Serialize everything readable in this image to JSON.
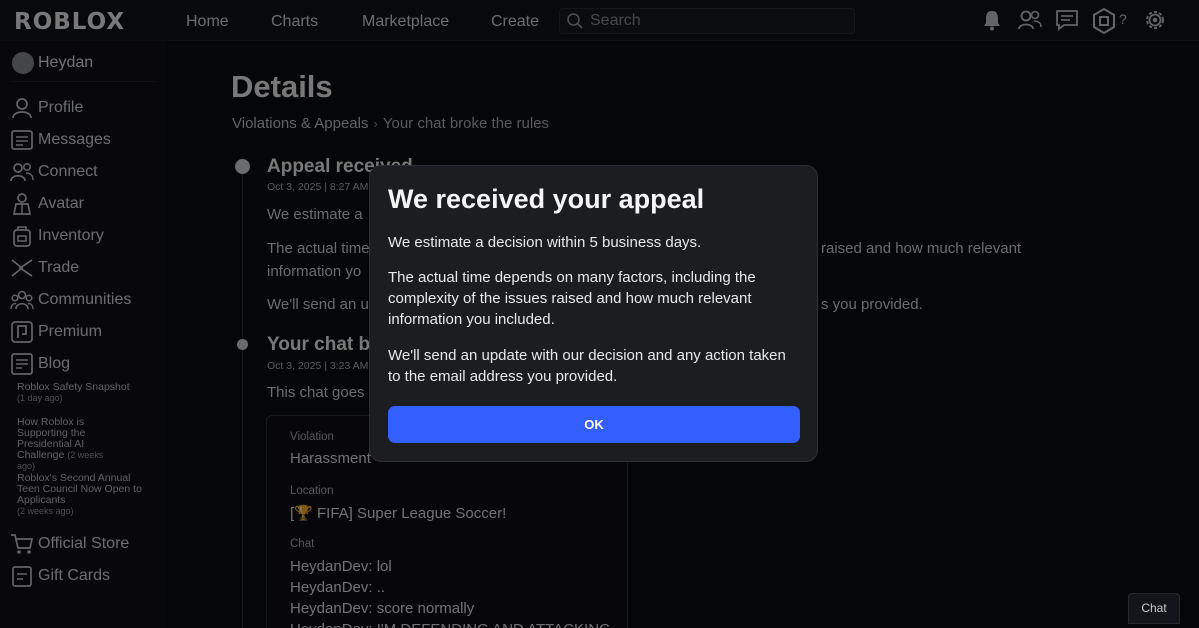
{
  "topbar": {
    "logo": "ROBLOX",
    "nav": [
      "Home",
      "Charts",
      "Marketplace",
      "Create"
    ],
    "search_placeholder": "Search",
    "robux_help": "?",
    "icons": [
      "bell-icon",
      "friends-icon",
      "chat-icon",
      "robux-icon",
      "settings-icon"
    ]
  },
  "sidebar": {
    "username": "Heydan",
    "items": [
      {
        "label": "Profile",
        "icon": "profile-icon"
      },
      {
        "label": "Messages",
        "icon": "messages-icon"
      },
      {
        "label": "Connect",
        "icon": "connect-icon"
      },
      {
        "label": "Avatar",
        "icon": "avatar-icon"
      },
      {
        "label": "Inventory",
        "icon": "inventory-icon"
      },
      {
        "label": "Trade",
        "icon": "trade-icon"
      },
      {
        "label": "Communities",
        "icon": "communities-icon"
      },
      {
        "label": "Premium",
        "icon": "premium-icon"
      },
      {
        "label": "Blog",
        "icon": "blog-icon"
      }
    ],
    "blog_posts": [
      {
        "title": "Roblox Safety Snapshot",
        "ago": "(1 day ago)"
      },
      {
        "title": "How Roblox is Supporting the Presidential AI Challenge",
        "ago": "(2 weeks ago)"
      },
      {
        "title": "Roblox's Second Annual Teen Council Now Open to Applicants",
        "ago": "(2 weeks ago)"
      }
    ],
    "bottom_items": [
      {
        "label": "Official Store",
        "icon": "cart-icon"
      },
      {
        "label": "Gift Cards",
        "icon": "gift-card-icon"
      }
    ]
  },
  "main": {
    "title": "Details",
    "breadcrumb": {
      "parent": "Violations & Appeals",
      "separator": "›",
      "current": "Your chat broke the rules"
    },
    "events": [
      {
        "title": "Appeal received",
        "time": "Oct 3, 2025 | 8:27 AM",
        "lines": [
          "We estimate a",
          "The actual time",
          "information yo",
          "We'll send an u"
        ],
        "right_fragments": [
          "raised and how much relevant",
          "s you provided."
        ]
      },
      {
        "title": "Your chat b",
        "time": "Oct 3, 2025 | 3:23 AM",
        "lines": [
          "This chat goes"
        ]
      }
    ],
    "details": {
      "violation_label": "Violation",
      "violation_value": "Harassment",
      "location_label": "Location",
      "location_value": "[🏆 FIFA] Super League Soccer!",
      "chat_label": "Chat",
      "chat_lines": [
        "HeydanDev: lol",
        "HeydanDev: ..",
        "HeydanDev: score normally",
        "HeydanDev: I'M DEFENDING AND ATTACKING"
      ]
    }
  },
  "modal": {
    "title": "We received your appeal",
    "p1": "We estimate a decision within 5 business days.",
    "p2": "The actual time depends on many factors, including the complexity of the issues raised and how much relevant information you included.",
    "p3": "We'll send an update with our decision and any action taken to the email address you provided.",
    "ok_label": "OK"
  },
  "chat_button": "Chat",
  "colors": {
    "accent": "#335fff",
    "modal_bg": "#1c1d21",
    "page_bg": "#0b0c0e"
  }
}
